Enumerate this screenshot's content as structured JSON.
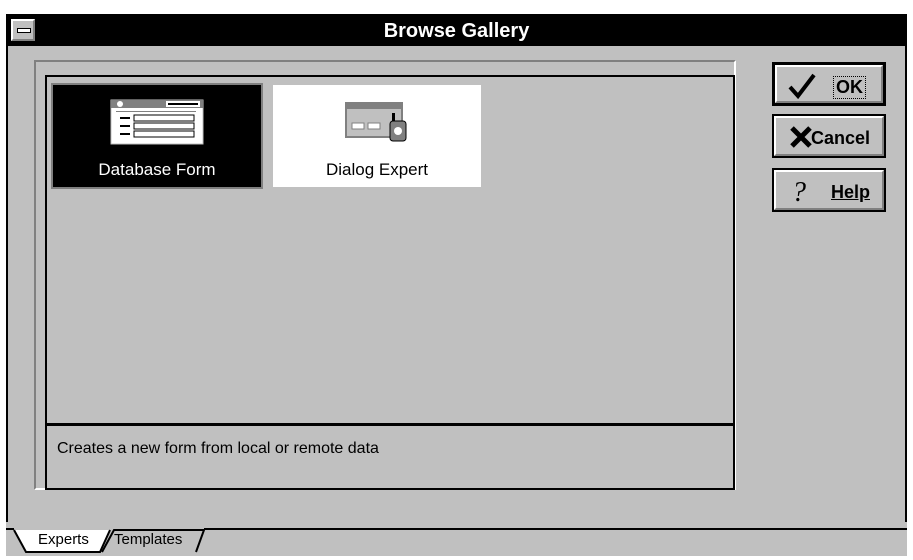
{
  "window": {
    "title": "Browse Gallery"
  },
  "gallery": {
    "items": [
      {
        "label": "Database Form",
        "selected": true,
        "icon": "database-form-icon"
      },
      {
        "label": "Dialog Expert",
        "selected": false,
        "icon": "dialog-expert-icon"
      }
    ],
    "description": "Creates a new form from local or remote data"
  },
  "buttons": {
    "ok": {
      "label": "OK",
      "icon": "checkmark-icon"
    },
    "cancel": {
      "label": "Cancel",
      "icon": "x-icon"
    },
    "help": {
      "label": "Help",
      "icon": "question-icon"
    }
  },
  "tabs": {
    "experts": "Experts",
    "templates": "Templates"
  },
  "colors": {
    "face": "#c0c0c0",
    "titlebar": "#000000",
    "selection": "#000000"
  }
}
